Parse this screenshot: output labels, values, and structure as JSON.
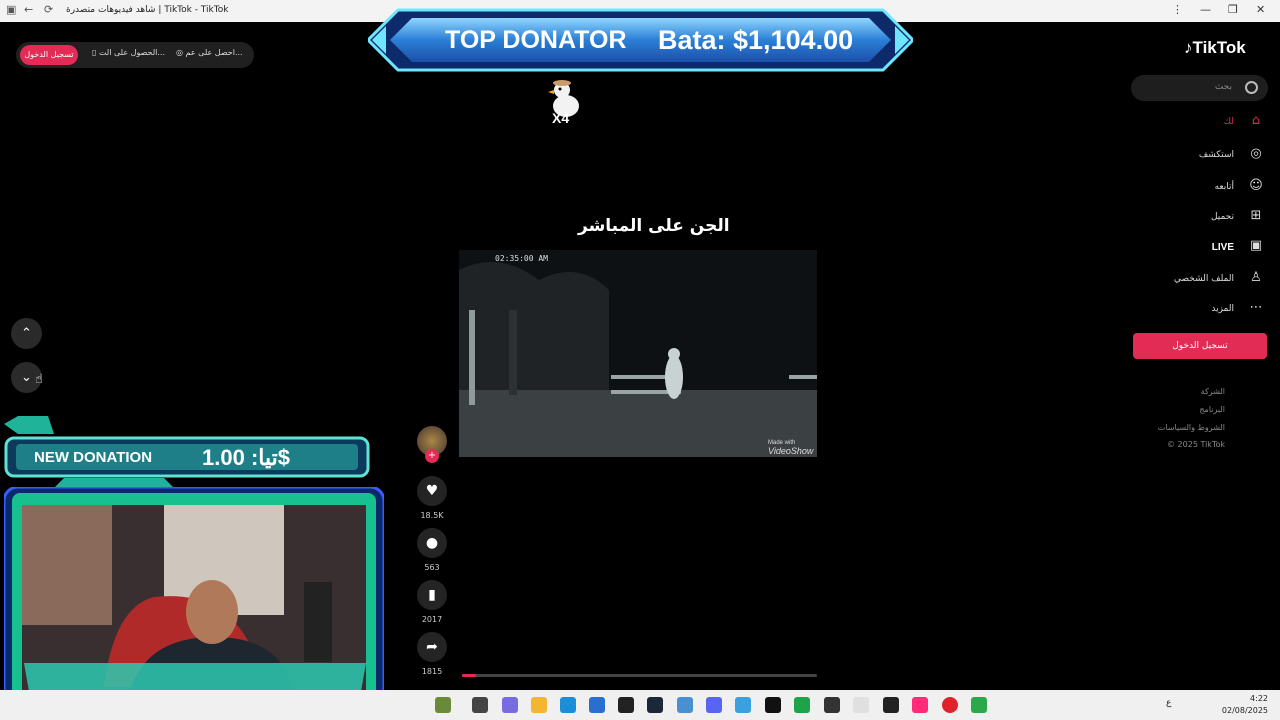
{
  "browser": {
    "title": "شاهد فيديوهات متصدرة | TikTok - TikTok",
    "window_controls": [
      "more-icon",
      "minimize-icon",
      "restore-icon",
      "close-icon"
    ]
  },
  "header": {
    "login_pill": "تسجيل الدخول",
    "get_app_pill": "الحصول على الت...",
    "get_coins_pill": "احصل على عم..."
  },
  "sidebar": {
    "logo": "TikTok",
    "search_placeholder": "بحث",
    "items": [
      {
        "label": "لك",
        "icon": "home-icon",
        "active": true
      },
      {
        "label": "استكشف",
        "icon": "compass-icon"
      },
      {
        "label": "أتابعه",
        "icon": "following-icon"
      },
      {
        "label": "تحميل",
        "icon": "upload-icon"
      },
      {
        "label": "LIVE",
        "icon": "live-icon"
      },
      {
        "label": "الملف الشخصي",
        "icon": "profile-icon"
      },
      {
        "label": "المزيد",
        "icon": "more-icon"
      }
    ],
    "login_button": "تسجيل الدخول",
    "footer": [
      "الشركة",
      "البرنامج",
      "الشروط والسياسات",
      "© 2025 TikTok"
    ]
  },
  "overlay": {
    "banner_left": "TOP DONATOR",
    "banner_right": "Bata: $1,104.00",
    "duck_multiplier": "X4",
    "donation_left": "NEW DONATION",
    "donation_right": "تيا: 1.00$"
  },
  "video": {
    "title": "الجن على المباشر",
    "timestamp": "02:35:00 AM",
    "watermark_top": "Made with",
    "watermark": "VideoShow",
    "progress": 0.04
  },
  "actions": {
    "likes": "18.5K",
    "comments": "563",
    "bookmarks": "2017",
    "shares": "1815"
  },
  "taskbar": {
    "time": "4:22",
    "date": "02/08/2025",
    "lang": "ع"
  },
  "colors": {
    "accent": "#e32c55",
    "banner_blue": "#2b7fd6",
    "donation_teal": "#1fb39a"
  }
}
